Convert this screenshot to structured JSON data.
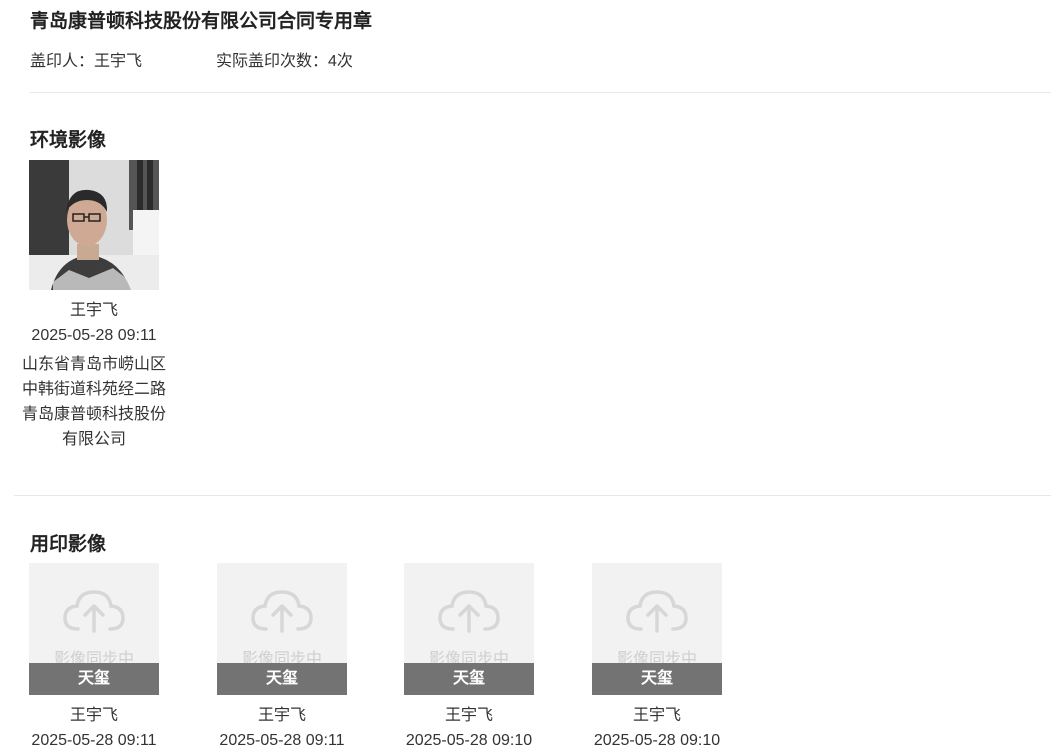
{
  "header": {
    "title": "青岛康普顿科技股份有限公司合同专用章",
    "stamper_label": "盖印人：",
    "stamper_name": "王宇飞",
    "count_label": "实际盖印次数：",
    "count_value": "4次"
  },
  "environment": {
    "section_title": "环境影像",
    "items": [
      {
        "name": "王宇飞",
        "time": "2025-05-28 09:11",
        "address_lines": [
          "山东省青岛市崂山区",
          "中韩街道科苑经二路",
          "青岛康普顿科技股份",
          "有限公司"
        ]
      }
    ]
  },
  "seal_images": {
    "section_title": "用印影像",
    "items": [
      {
        "status": "影像同步中",
        "type": "天玺",
        "name": "王宇飞",
        "time": "2025-05-28 09:11",
        "icon": "cloud-upload-icon"
      },
      {
        "status": "影像同步中",
        "type": "天玺",
        "name": "王宇飞",
        "time": "2025-05-28 09:11",
        "icon": "cloud-upload-icon"
      },
      {
        "status": "影像同步中",
        "type": "天玺",
        "name": "王宇飞",
        "time": "2025-05-28 09:10",
        "icon": "cloud-upload-icon"
      },
      {
        "status": "影像同步中",
        "type": "天玺",
        "name": "王宇飞",
        "time": "2025-05-28 09:10",
        "icon": "cloud-upload-icon"
      }
    ]
  },
  "colors": {
    "type_bar": "#737373",
    "placeholder_bg": "#f2f2f2",
    "divider": "#e8e8e8"
  }
}
